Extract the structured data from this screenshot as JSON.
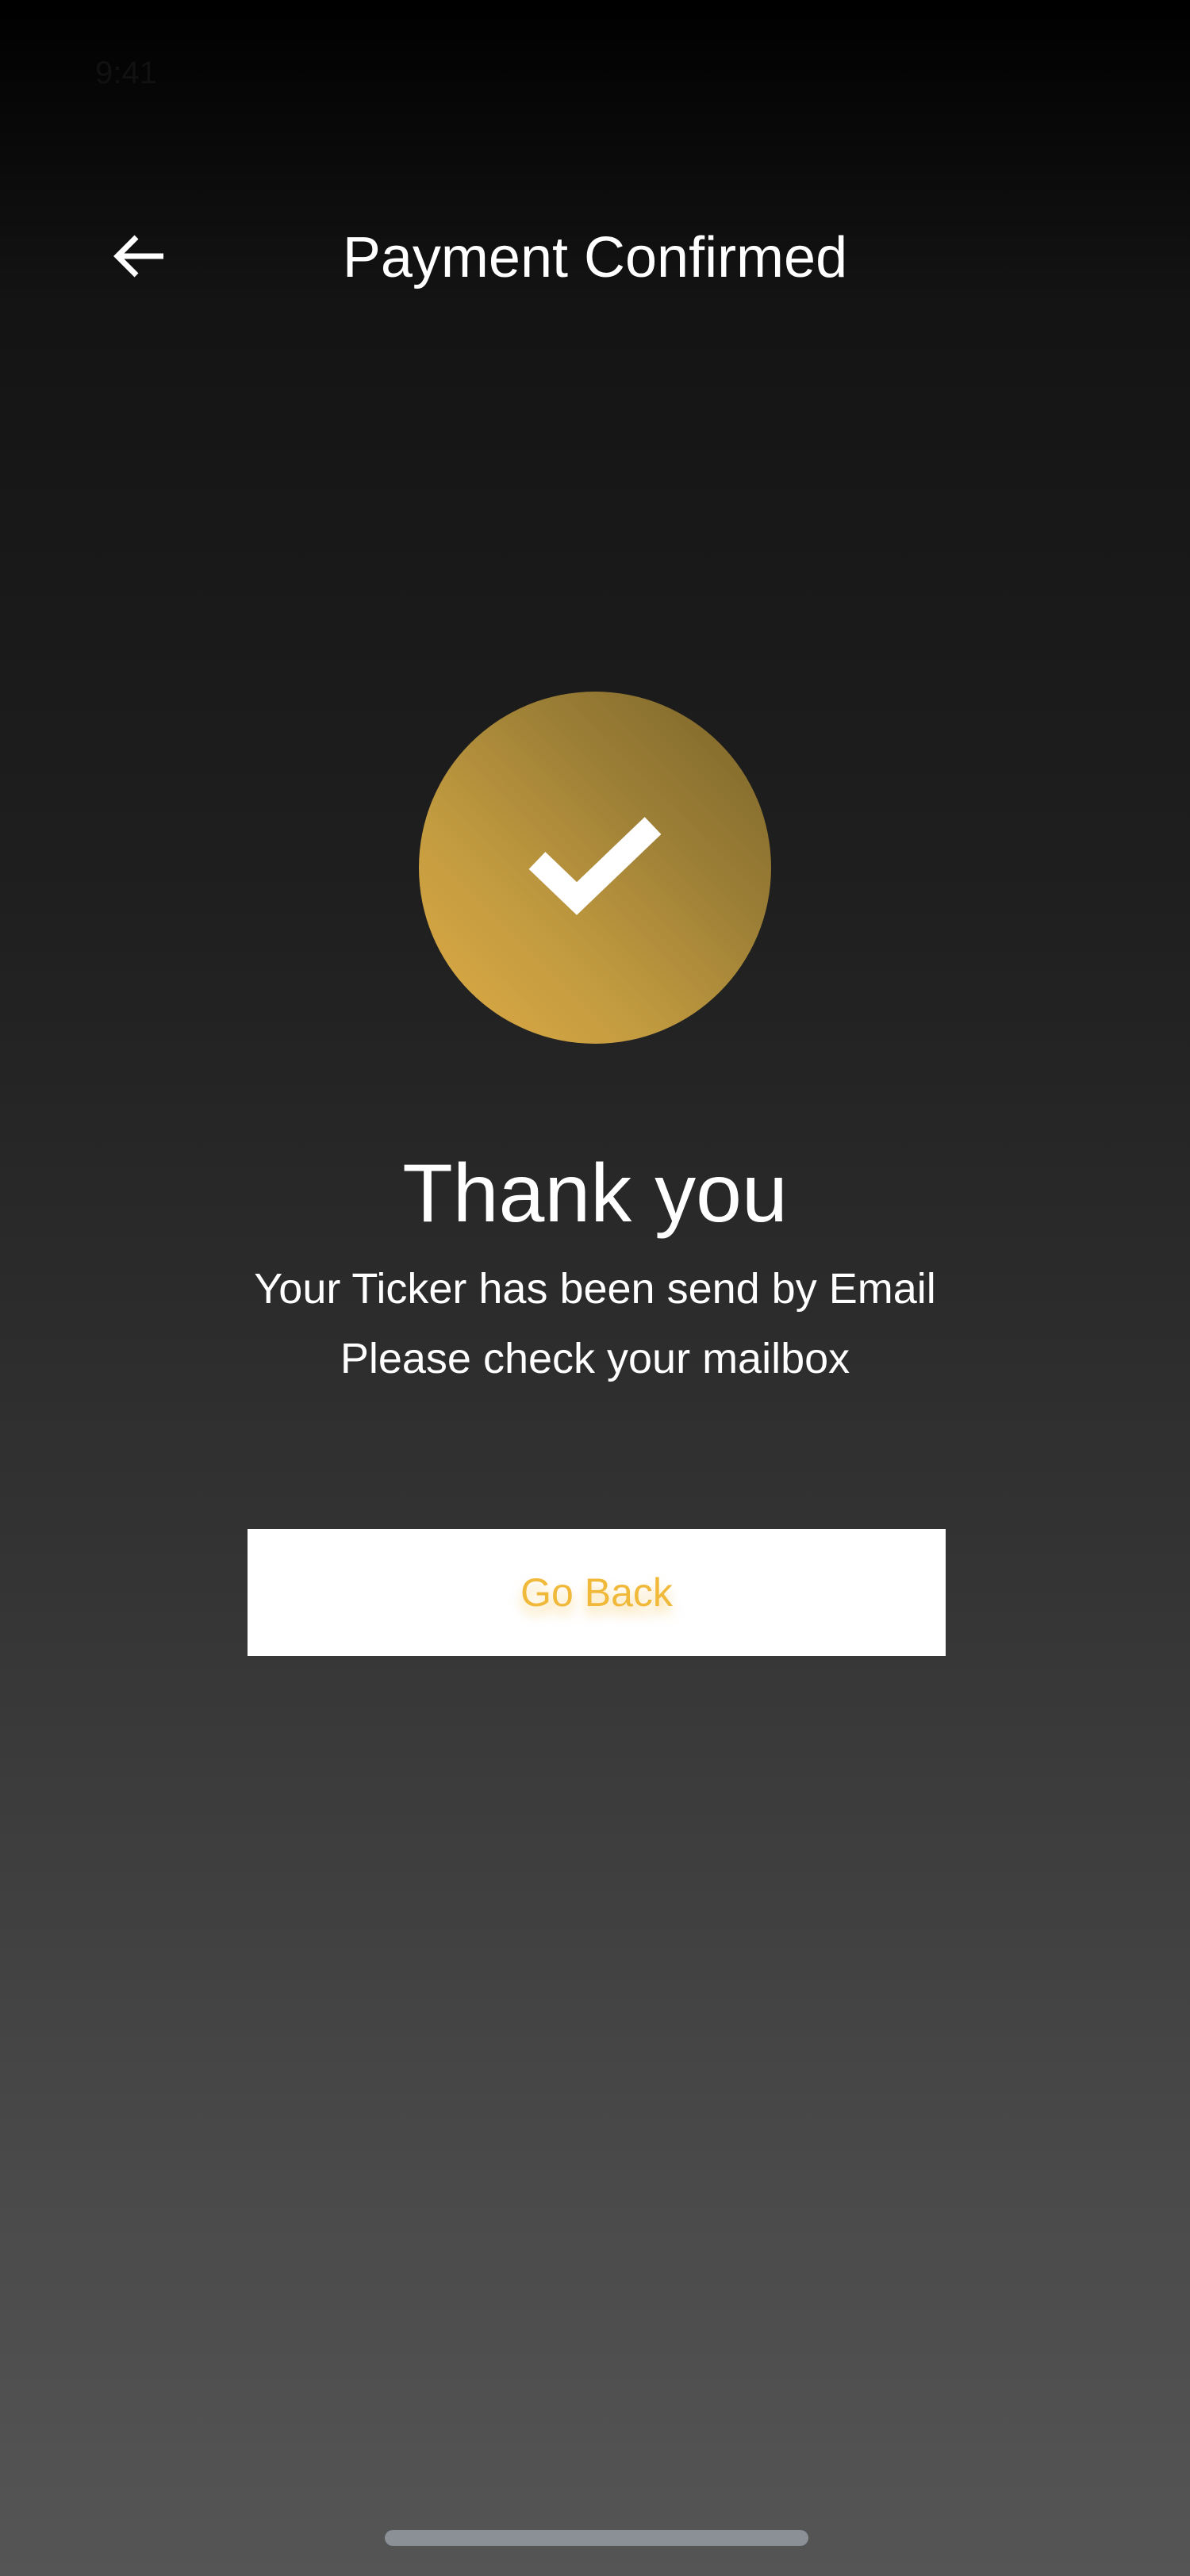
{
  "status_bar": {
    "time": "9:41"
  },
  "header": {
    "back_icon": "arrow-left-icon",
    "title": "Payment Confirmed"
  },
  "confirmation": {
    "icon": "checkmark-icon",
    "heading": "Thank you",
    "message_line_1": "Your Ticker has been send by Email",
    "message_line_2": "Please check your mailbox"
  },
  "actions": {
    "go_back_label": "Go Back"
  },
  "colors": {
    "accent_gold": "#e0ab45",
    "button_text": "#f0b93a",
    "button_background": "#ffffff"
  }
}
